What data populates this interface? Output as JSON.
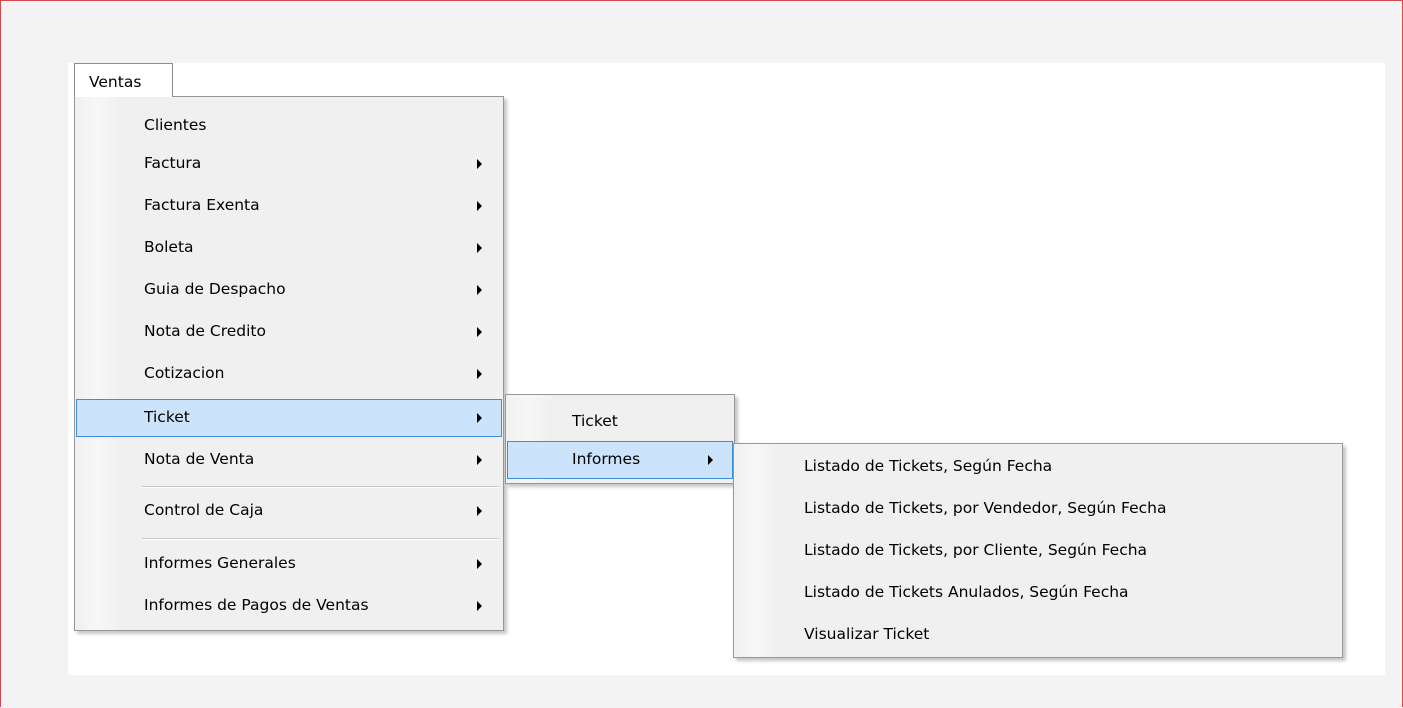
{
  "menubar": {
    "ventas_label": "Ventas"
  },
  "ventas_menu": {
    "items": [
      {
        "label": "Clientes"
      },
      {
        "label": "Factura"
      },
      {
        "label": "Factura Exenta"
      },
      {
        "label": "Boleta"
      },
      {
        "label": "Guia de Despacho"
      },
      {
        "label": "Nota de Credito"
      },
      {
        "label": "Cotizacion"
      },
      {
        "label": "Ticket"
      },
      {
        "label": "Nota de Venta"
      },
      {
        "label": "Control de Caja"
      },
      {
        "label": "Informes Generales"
      },
      {
        "label": "Informes de Pagos de Ventas"
      }
    ]
  },
  "ticket_submenu": {
    "items": [
      {
        "label": "Ticket"
      },
      {
        "label": "Informes"
      }
    ]
  },
  "informes_submenu": {
    "items": [
      {
        "label": "Listado de Tickets, Según Fecha"
      },
      {
        "label": "Listado de Tickets, por Vendedor, Según Fecha"
      },
      {
        "label": "Listado de Tickets, por Cliente, Según Fecha"
      },
      {
        "label": "Listado de Tickets Anulados, Según Fecha"
      },
      {
        "label": "Visualizar Ticket"
      }
    ]
  },
  "colors": {
    "highlight_bg": "#cce4fb",
    "highlight_border": "#3f8fd6",
    "frame_border": "#d6474f"
  }
}
